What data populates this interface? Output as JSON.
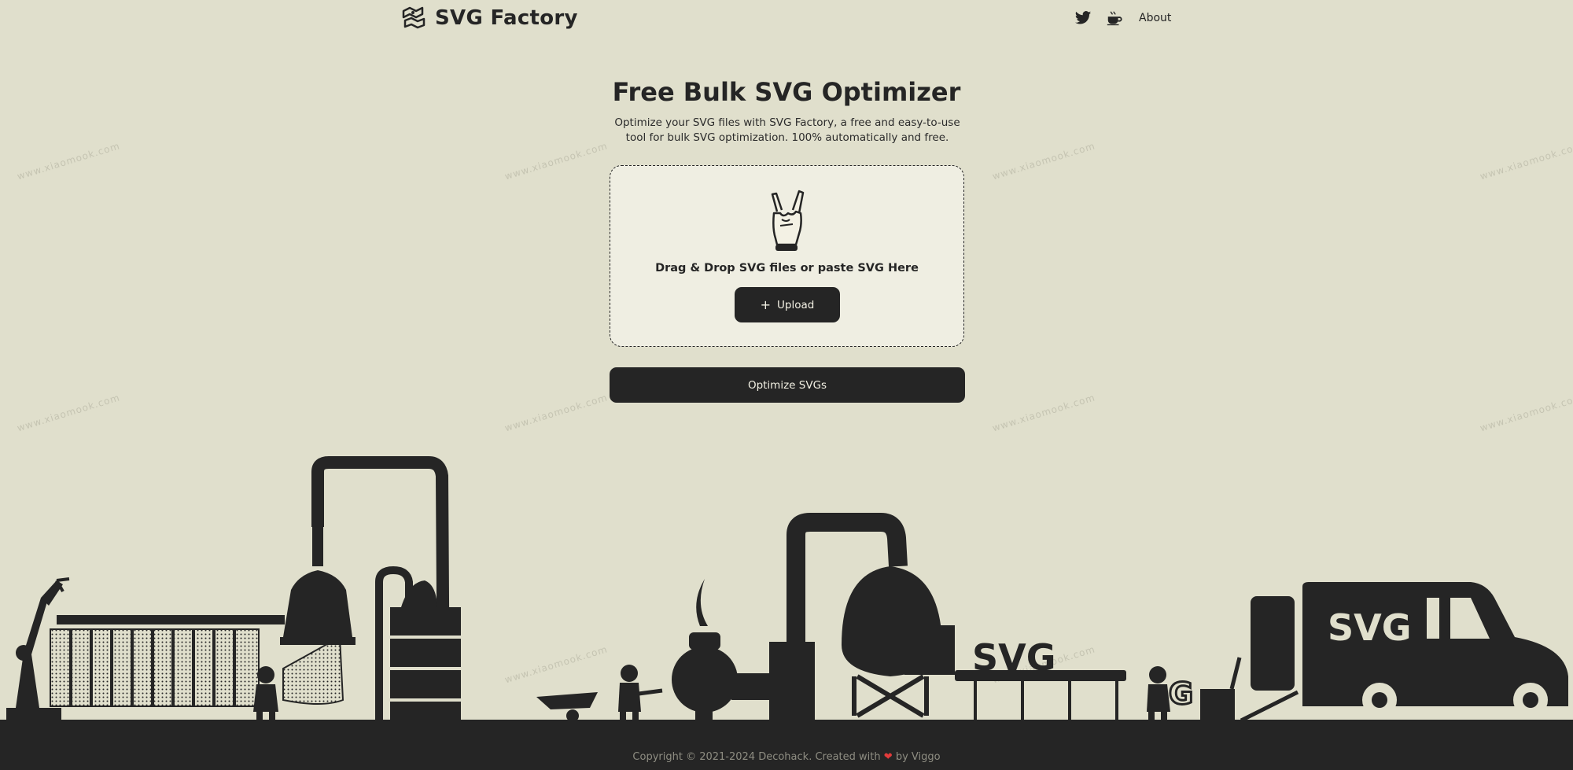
{
  "header": {
    "logo_text": "SVG Factory",
    "logo_icon": "factory-logo-icon",
    "nav": {
      "twitter_icon": "twitter-icon",
      "coffee_icon": "coffee-cup-icon",
      "about_label": "About"
    }
  },
  "hero": {
    "title": "Free Bulk SVG Optimizer",
    "subtitle": "Optimize your SVG files with SVG Factory, a free and easy-to-use tool for bulk SVG optimization. 100% automatically and free."
  },
  "dropzone": {
    "icon": "rock-hand-icon",
    "text": "Drag & Drop SVG files or paste SVG Here",
    "upload_label": "Upload",
    "upload_icon": "plus-icon"
  },
  "optimize_label": "Optimize SVGs",
  "watermark_text": "www.xiaomook.com",
  "illustration": {
    "truck_label": "SVG",
    "conveyor_label": "SVG",
    "carry_letter": "G"
  },
  "footer": {
    "copyright_prefix": "Copyright © 2021-2024 Decohack. Created with",
    "heart": "❤",
    "copyright_suffix": "by Viggo"
  },
  "colors": {
    "background": "#e0dfcc",
    "dark": "#252525",
    "dropzone_bg": "#efeee2",
    "button_text": "#f3f1e4",
    "heart": "#e23b3b"
  }
}
